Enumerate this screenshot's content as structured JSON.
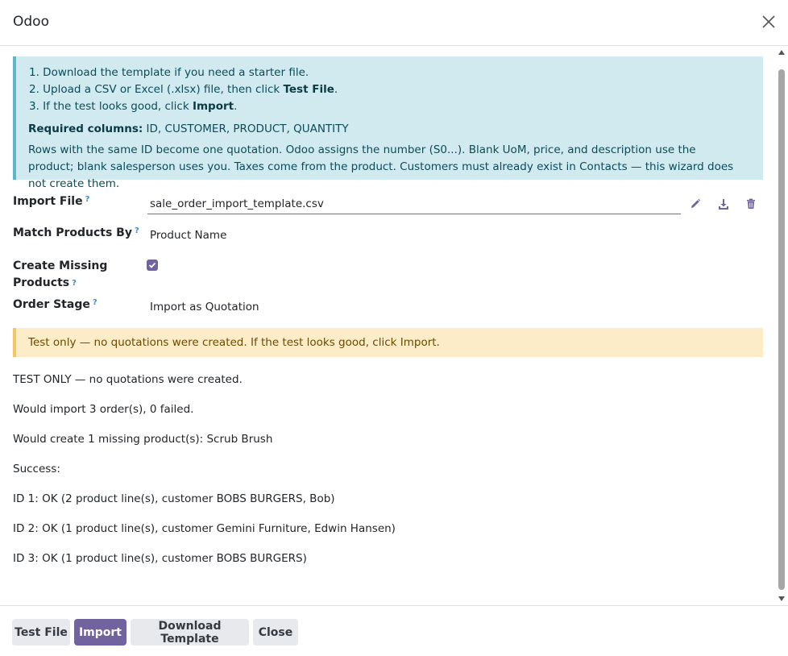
{
  "dialog": {
    "title": "Odoo"
  },
  "info": {
    "step1": "1. Download the template if you need a starter file.",
    "step2_pre": "2. Upload a CSV or Excel (.xlsx) file, then click ",
    "step2_bold": "Test File",
    "step2_post": ".",
    "step3_pre": "3. If the test looks good, click ",
    "step3_bold": "Import",
    "step3_post": ".",
    "required_label": "Required columns:",
    "required_value": " ID, CUSTOMER, PRODUCT, QUANTITY",
    "note": "Rows with the same ID become one quotation. Odoo assigns the number (S0...). Blank UoM, price, and description use the product; blank salesperson uses you. Taxes come from the product. Customers must already exist in Contacts — this wizard does not create them."
  },
  "form": {
    "import_file_label": "Import File",
    "import_file_value": "sale_order_import_template.csv",
    "match_label": "Match Products By",
    "match_value": "Product Name",
    "create_missing_label_1": "Create Missing",
    "create_missing_label_2": "Products",
    "create_missing_checked": true,
    "order_stage_label": "Order Stage",
    "order_stage_value": "Import as Quotation",
    "help_mark": "?"
  },
  "warning": "Test only — no quotations were created. If the test looks good, click Import.",
  "results": [
    "TEST ONLY — no quotations were created.",
    "Would import 3 order(s), 0 failed.",
    "Would create 1 missing product(s): Scrub Brush",
    "Success:",
    "ID 1: OK (2 product line(s), customer BOBS BURGERS, Bob)",
    "ID 2: OK (1 product line(s), customer Gemini Furniture, Edwin Hansen)",
    "ID 3: OK (1 product line(s), customer BOBS BURGERS)"
  ],
  "footer": {
    "test_file": "Test File",
    "import": "Import",
    "download_template": "Download Template",
    "close": "Close"
  },
  "colors": {
    "primary": "#71639e",
    "info_bg": "#d0eaf0",
    "warning_bg": "#fdecc8"
  },
  "icons": [
    "close-icon",
    "pencil-icon",
    "download-icon",
    "trash-icon",
    "checkmark-icon"
  ]
}
